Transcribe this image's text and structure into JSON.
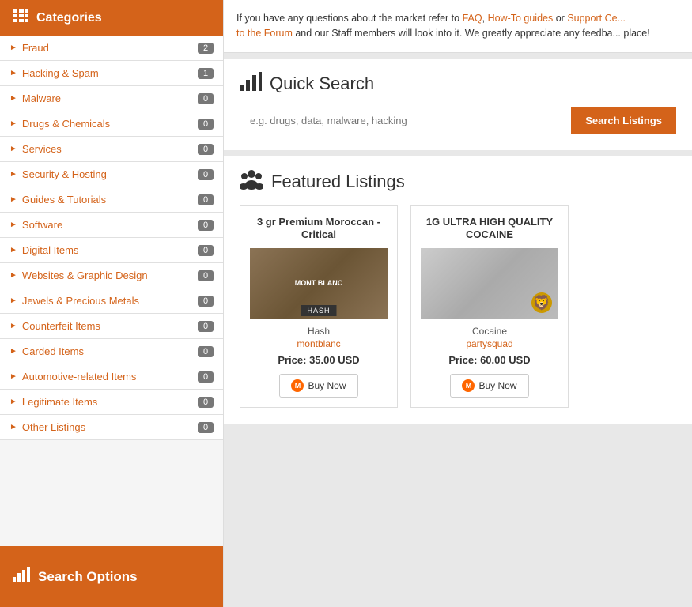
{
  "sidebar": {
    "header_label": "Categories",
    "footer_label": "Search Options",
    "categories": [
      {
        "name": "Fraud",
        "badge": "2"
      },
      {
        "name": "Hacking & Spam",
        "badge": "1"
      },
      {
        "name": "Malware",
        "badge": "0"
      },
      {
        "name": "Drugs & Chemicals",
        "badge": "0"
      },
      {
        "name": "Services",
        "badge": "0"
      },
      {
        "name": "Security & Hosting",
        "badge": "0"
      },
      {
        "name": "Guides & Tutorials",
        "badge": "0"
      },
      {
        "name": "Software",
        "badge": "0"
      },
      {
        "name": "Digital Items",
        "badge": "0"
      },
      {
        "name": "Websites & Graphic Design",
        "badge": "0"
      },
      {
        "name": "Jewels & Precious Metals",
        "badge": "0"
      },
      {
        "name": "Counterfeit Items",
        "badge": "0"
      },
      {
        "name": "Carded Items",
        "badge": "0"
      },
      {
        "name": "Automotive-related Items",
        "badge": "0"
      },
      {
        "name": "Legitimate Items",
        "badge": "0"
      },
      {
        "name": "Other Listings",
        "badge": "0"
      }
    ]
  },
  "info_banner": {
    "text_before_faq": "If you have any questions about the market refer to ",
    "faq_label": "FAQ",
    "comma_howto": ", ",
    "howto_label": "How-To guides",
    "text_or": " or ",
    "support_label": "Support Ce...",
    "text_to_forum": "to the Forum",
    "text_after": " and our Staff members will look into it. We greatly appreciate any feedba... place!"
  },
  "quick_search": {
    "title": "Quick Search",
    "placeholder": "e.g. drugs, data, malware, hacking",
    "button_label": "Search Listings"
  },
  "featured": {
    "title": "Featured Listings",
    "listings": [
      {
        "title": "3 gr Premium Moroccan - Critical",
        "image_type": "hash",
        "category": "Hash",
        "vendor": "montblanc",
        "price": "Price: 35.00 USD",
        "buy_label": "Buy Now"
      },
      {
        "title": "1G ULTRA HIGH QUALITY COCAINE",
        "image_type": "cocaine",
        "category": "Cocaine",
        "vendor": "partysquad",
        "price": "Price: 60.00 USD",
        "buy_label": "Buy Now"
      }
    ]
  },
  "colors": {
    "accent": "#d4631a",
    "badge_bg": "#777"
  }
}
